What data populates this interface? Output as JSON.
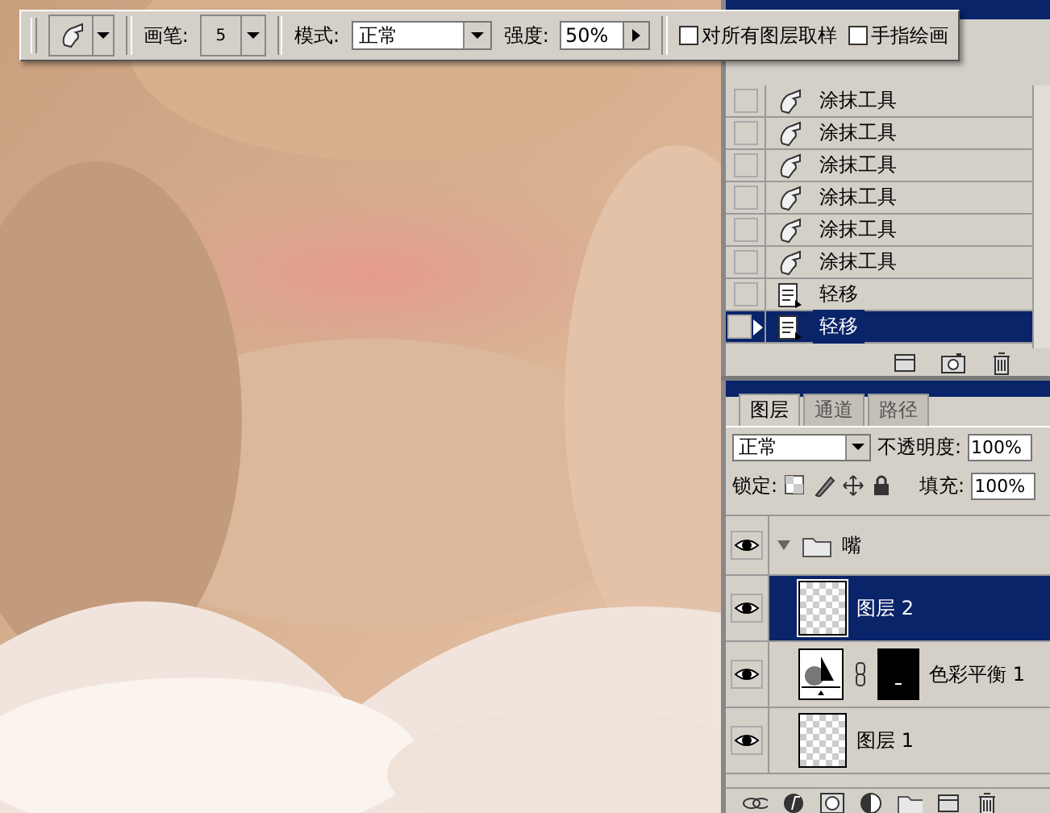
{
  "toolbar": {
    "brush_label": "画笔:",
    "brush_size": "5",
    "mode_label": "模式:",
    "mode": "正常",
    "strength_label": "强度:",
    "strength": "50%",
    "options": [
      {
        "label": "对所有图层取样",
        "checked": false
      },
      {
        "label": "手指绘画",
        "checked": false
      }
    ]
  },
  "history": {
    "items": [
      {
        "kind": "smudge",
        "label": "涂抹工具",
        "snapshot": false,
        "selected": false
      },
      {
        "kind": "smudge",
        "label": "涂抹工具",
        "snapshot": false,
        "selected": false
      },
      {
        "kind": "smudge",
        "label": "涂抹工具",
        "snapshot": false,
        "selected": false
      },
      {
        "kind": "smudge",
        "label": "涂抹工具",
        "snapshot": false,
        "selected": false
      },
      {
        "kind": "smudge",
        "label": "涂抹工具",
        "snapshot": false,
        "selected": false
      },
      {
        "kind": "smudge",
        "label": "涂抹工具",
        "snapshot": false,
        "selected": false
      },
      {
        "kind": "nudge",
        "label": "轻移",
        "snapshot": false,
        "selected": false
      },
      {
        "kind": "nudge",
        "label": "轻移",
        "snapshot": false,
        "selected": true
      }
    ]
  },
  "layers": {
    "tabs": [
      {
        "label": "图层",
        "selected": true
      },
      {
        "label": "通道",
        "selected": false
      },
      {
        "label": "路径",
        "selected": false
      }
    ],
    "blend_mode": "正常",
    "opacity_label": "不透明度:",
    "opacity": "100%",
    "lock_label": "锁定:",
    "fill_label": "填充:",
    "fill": "100%",
    "items": [
      {
        "kind": "group",
        "name": "嘴",
        "visible": true,
        "expanded": true,
        "selected": false,
        "children": [
          {
            "kind": "layer",
            "name": "图层 2",
            "visible": true,
            "selected": true
          },
          {
            "kind": "adjustment",
            "name": "色彩平衡 1",
            "visible": true,
            "selected": false
          },
          {
            "kind": "layer",
            "name": "图层 1",
            "visible": true,
            "selected": false
          }
        ]
      }
    ]
  }
}
